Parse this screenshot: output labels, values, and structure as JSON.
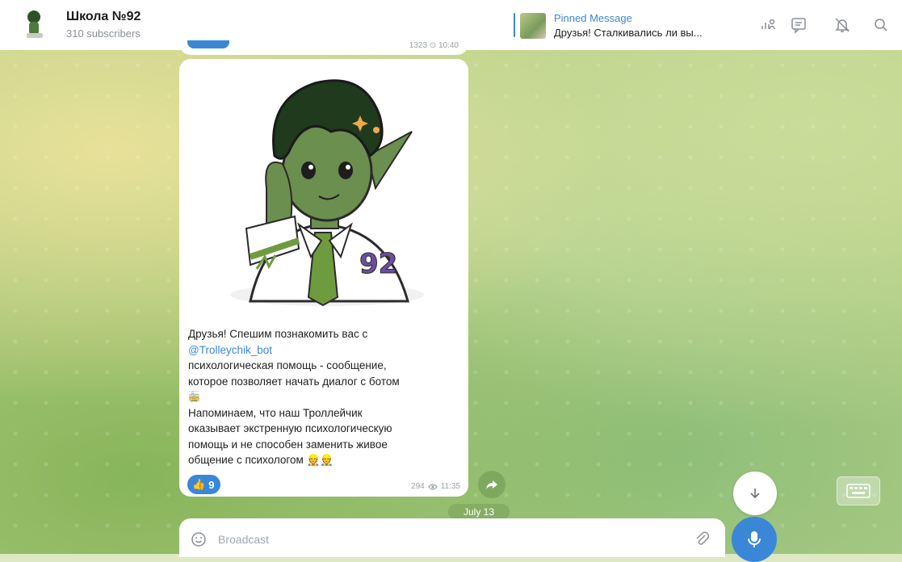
{
  "header": {
    "title": "Школа №92",
    "subtitle": "310 subscribers",
    "pinned": {
      "label": "Pinned Message",
      "text": "Друзья! Сталкивались ли вы..."
    }
  },
  "prev_message": {
    "meta": "1323 ⊙ 10:40"
  },
  "message": {
    "lines": [
      "Друзья! Спешим познакомить вас с",
      "@Trolleychik_bot",
      "психологическая помощь - сообщение,",
      "которое позволяет начать диалог с ботом",
      "🚋",
      "Напоминаем, что наш Троллейчик",
      "оказывает экстренную психологическую",
      "помощь и не способен заменить живое",
      "общение с психологом 👷👷"
    ],
    "reaction": {
      "emoji": "👍",
      "count": "9"
    },
    "meta": {
      "views": "294",
      "time": "11:35"
    }
  },
  "date_pill": "July 13",
  "composer": {
    "placeholder": "Broadcast"
  },
  "icons": {
    "header": [
      "voice-chat-icon",
      "comments-icon",
      "mute-icon",
      "search-icon"
    ],
    "composer": [
      "emoji-icon",
      "attach-icon",
      "microphone-icon"
    ]
  },
  "colors": {
    "accent": "#3a87d8",
    "bubble": "#ffffff",
    "sticker_green": "#3f6b35"
  }
}
